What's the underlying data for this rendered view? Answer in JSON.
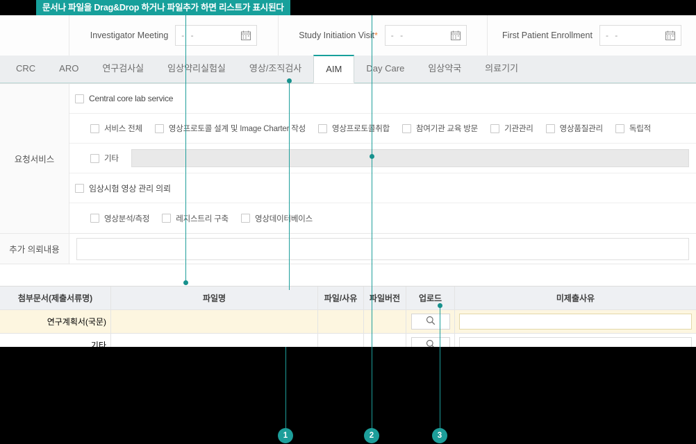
{
  "banner": {
    "text": "문서나 파일을 Drag&Drop 하거나 파일추가 하면 리스트가 표시된다"
  },
  "milestones": {
    "items": [
      {
        "label": "Investigator Meeting",
        "required": false,
        "star": "",
        "date_placeholder": "- -",
        "calendar_icon": "calendar-icon"
      },
      {
        "label": "Study Initiation Visit",
        "required": true,
        "star": "*",
        "date_placeholder": "- -",
        "calendar_icon": "calendar-icon"
      },
      {
        "label": "First Patient Enrollment",
        "required": false,
        "star": "",
        "date_placeholder": "- -",
        "calendar_icon": "calendar-icon"
      }
    ]
  },
  "tabs": {
    "active": "AIM",
    "items": [
      {
        "label": "CRC",
        "active": false
      },
      {
        "label": "ARO",
        "active": false
      },
      {
        "label": "연구검사실",
        "active": false
      },
      {
        "label": "임상약리실험실",
        "active": false
      },
      {
        "label": "영상/조직검사",
        "active": false
      },
      {
        "label": "AIM",
        "active": true
      },
      {
        "label": "Day Care",
        "active": false
      },
      {
        "label": "임상약국",
        "active": false
      },
      {
        "label": "의료기기",
        "active": false
      }
    ]
  },
  "form": {
    "service_row_label": "요청서비스",
    "note_row_label": "추가 의뢰내용",
    "note_value": "",
    "rows": [
      {
        "type": "checkbox-line",
        "items": [
          {
            "label": "Central core lab service",
            "checked": false
          }
        ]
      },
      {
        "type": "checkbox-line",
        "indent": true,
        "items": [
          {
            "label": "서비스 전체",
            "checked": false
          },
          {
            "label": "영상프로토콜 설계 및 Image Charter 작성",
            "checked": false
          },
          {
            "label": "영상프로토콜취합",
            "checked": false
          },
          {
            "label": "참여기관 교육 방문",
            "checked": false
          },
          {
            "label": "기관관리",
            "checked": false
          },
          {
            "label": "영상품질관리",
            "checked": false
          },
          {
            "label": "독립적",
            "checked": false
          }
        ]
      },
      {
        "type": "etc-line",
        "indent": true,
        "checkbox": {
          "label": "기타",
          "checked": false
        },
        "input_value": "",
        "input_disabled": true
      },
      {
        "type": "checkbox-line",
        "items": [
          {
            "label": "임상시험 영상 관리 의뢰",
            "checked": false
          }
        ]
      },
      {
        "type": "checkbox-line",
        "indent": true,
        "items": [
          {
            "label": "영상분석/측정",
            "checked": false
          },
          {
            "label": "레지스트리 구축",
            "checked": false
          },
          {
            "label": "영상데이터베이스",
            "checked": false
          }
        ]
      }
    ]
  },
  "attachments": {
    "columns": [
      "첨부문서(제출서류명)",
      "파일명",
      "파일/사유",
      "파일버전",
      "업로드",
      "미제출사유"
    ],
    "upload_icon": "search-icon",
    "rows": [
      {
        "doc_name": "연구계획서(국문)",
        "file_name": "",
        "file_reason": "",
        "file_version": "",
        "upload_label": "",
        "not_submitted_reason": "",
        "selected": true
      },
      {
        "doc_name": "기타",
        "file_name": "",
        "file_reason": "",
        "file_version": "",
        "upload_label": "",
        "not_submitted_reason": "",
        "selected": false
      }
    ]
  },
  "callouts": [
    {
      "number": "1"
    },
    {
      "number": "2"
    },
    {
      "number": "3"
    }
  ]
}
